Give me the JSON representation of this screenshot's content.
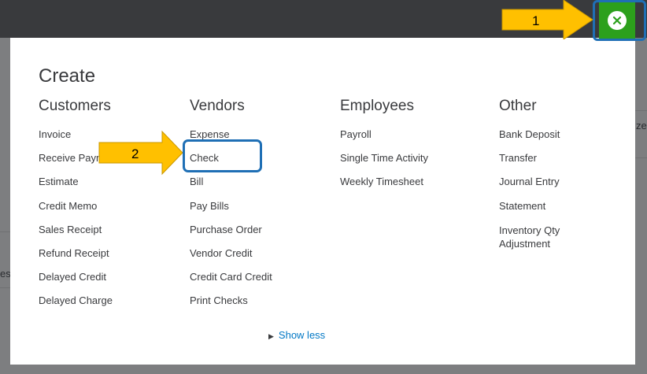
{
  "create_title": "Create",
  "columns": [
    {
      "heading": "Customers",
      "items": [
        "Invoice",
        "Receive Payment",
        "Estimate",
        "Credit Memo",
        "Sales Receipt",
        "Refund Receipt",
        "Delayed Credit",
        "Delayed Charge"
      ]
    },
    {
      "heading": "Vendors",
      "items": [
        "Expense",
        "Check",
        "Bill",
        "Pay Bills",
        "Purchase Order",
        "Vendor Credit",
        "Credit Card Credit",
        "Print Checks"
      ]
    },
    {
      "heading": "Employees",
      "items": [
        "Payroll",
        "Single Time Activity",
        "Weekly Timesheet"
      ]
    },
    {
      "heading": "Other",
      "items": [
        "Bank Deposit",
        "Transfer",
        "Journal Entry",
        "Statement",
        "Inventory Qty Adjustment"
      ]
    }
  ],
  "show_less": "Show less",
  "background": {
    "fragment_right": "ze",
    "fragment_left": "es"
  },
  "annotations": {
    "arrow1_label": "1",
    "arrow2_label": "2"
  },
  "colors": {
    "topbar": "#393a3d",
    "close_button": "#2ca01c",
    "link": "#0077c5",
    "annotation_arrow": "#ffc000",
    "annotation_box": "#1f6fb5"
  },
  "icons": {
    "close": "close-circle-icon",
    "show_less": "caret-right-icon",
    "arrow": "callout-arrow"
  }
}
